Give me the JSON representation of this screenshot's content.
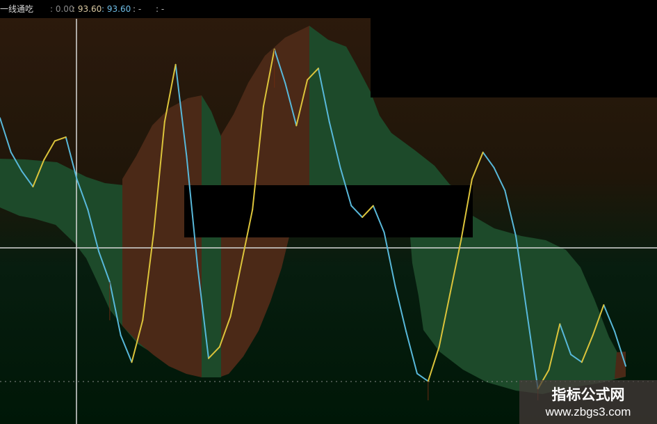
{
  "indicator": {
    "name": "一线通吃",
    "value_white": ": 0.00",
    "value_yellow": ": 93.60",
    "value_blue": ": 93.60",
    "value_dash_1": ": -",
    "value_dash_2": ": -"
  },
  "watermark": {
    "title": "指标公式网",
    "url": "www.zbgs3.com"
  },
  "colors": {
    "background_top": "#2e1d0e",
    "background_bottom": "#001b08",
    "brown_band": "#4b2917",
    "green_band": "#1d4a2a",
    "blue_line": "#58b8da",
    "yellow_line": "#dcc43b",
    "crosshair": "#d7d7d7",
    "dotted_line": "#8b8b8b",
    "mask": "#000000",
    "watermark_background": "#463a3a"
  },
  "chart_data": {
    "type": "line",
    "ylim": [
      0,
      100
    ],
    "reference_levels": [
      50
    ],
    "grid": false,
    "legend": "none",
    "series": [
      {
        "values": [
          74,
          65,
          60,
          56,
          63,
          68,
          69,
          58,
          50,
          39,
          31,
          17,
          10,
          21,
          44,
          73,
          88,
          64,
          35,
          11,
          14,
          22,
          36,
          50,
          77,
          92,
          83,
          72,
          84,
          87,
          73,
          61,
          51,
          48,
          51,
          44,
          30,
          18,
          7,
          5,
          14,
          28,
          42,
          58,
          65,
          61,
          55,
          43,
          23,
          3,
          8,
          20,
          12,
          10,
          17,
          25,
          18,
          9
        ]
      }
    ]
  }
}
